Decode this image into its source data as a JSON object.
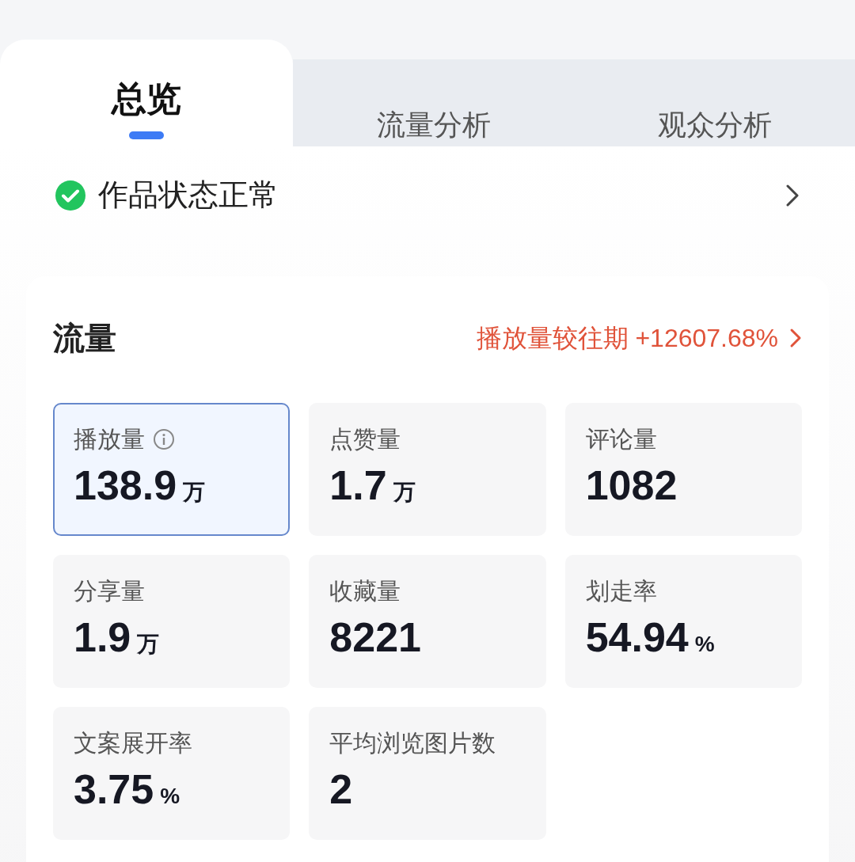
{
  "tabs": [
    {
      "label": "总览",
      "selected": true
    },
    {
      "label": "流量分析",
      "selected": false
    },
    {
      "label": "观众分析",
      "selected": false
    }
  ],
  "status": {
    "text": "作品状态正常",
    "ok": true
  },
  "card": {
    "title": "流量",
    "compare": "播放量较往期 +12607.68%",
    "metrics": [
      {
        "label": "播放量",
        "value": "138.9",
        "unit": "万",
        "selected": true,
        "info": true
      },
      {
        "label": "点赞量",
        "value": "1.7",
        "unit": "万",
        "selected": false,
        "info": false
      },
      {
        "label": "评论量",
        "value": "1082",
        "selected": false,
        "info": false
      },
      {
        "label": "分享量",
        "value": "1.9",
        "unit": "万",
        "selected": false,
        "info": false
      },
      {
        "label": "收藏量",
        "value": "8221",
        "selected": false,
        "info": false
      },
      {
        "label": "划走率",
        "value": "54.94",
        "unit": "%",
        "selected": false,
        "info": false
      },
      {
        "label": "文案展开率",
        "value": "3.75",
        "unit": "%",
        "selected": false,
        "info": false
      },
      {
        "label": "平均浏览图片数",
        "value": "2",
        "selected": false,
        "info": false
      }
    ]
  }
}
